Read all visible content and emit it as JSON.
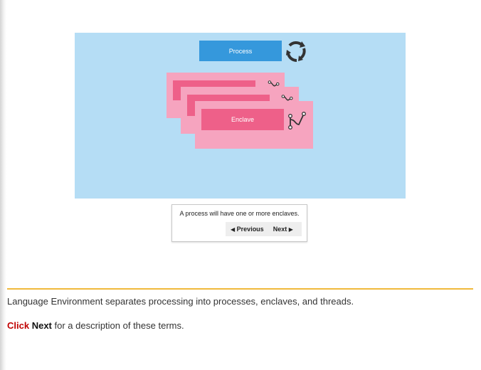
{
  "diagram": {
    "process_label": "Process",
    "enclave_label": "Enclave",
    "icons": {
      "cycle": "refresh-cycle-icon",
      "thread": "thread-branch-icon"
    },
    "colors": {
      "background": "#b5ddf5",
      "process": "#3598dc",
      "enclave_card": "#f6a4bf",
      "enclave_bar": "#ee6089"
    }
  },
  "navigation": {
    "caption": "A process will have one or more enclaves.",
    "previous_label": "Previous",
    "next_label": "Next"
  },
  "content": {
    "intro": "Language Environment separates processing into processes, enclaves, and threads.",
    "instruction_click": "Click",
    "instruction_next": "Next",
    "instruction_rest": "for a description of these terms.",
    "rule_color": "#f0b93b"
  }
}
